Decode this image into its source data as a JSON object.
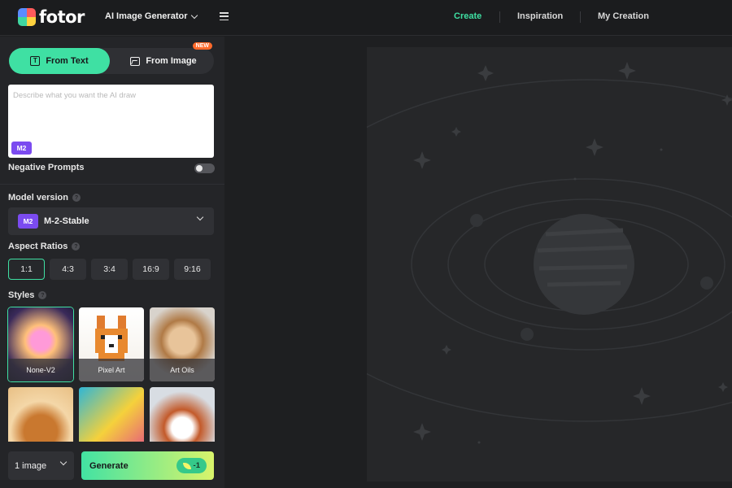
{
  "header": {
    "logo_text": "fotor",
    "product": "AI Image Generator",
    "nav": [
      {
        "label": "Create",
        "active": true
      },
      {
        "label": "Inspiration",
        "active": false
      },
      {
        "label": "My Creation",
        "active": false
      }
    ]
  },
  "sidebar": {
    "modes": {
      "from_text": "From Text",
      "from_image": "From Image",
      "new_badge": "NEW"
    },
    "prompt": {
      "placeholder": "Describe what you want the AI draw",
      "model_badge": "M2"
    },
    "negative_prompts": {
      "label": "Negative Prompts",
      "enabled": false
    },
    "model_version": {
      "label": "Model version",
      "badge": "M2",
      "selected": "M-2-Stable"
    },
    "aspect_ratios": {
      "label": "Aspect Ratios",
      "options": [
        "1:1",
        "4:3",
        "3:4",
        "16:9",
        "9:16"
      ],
      "selected": "1:1"
    },
    "styles": {
      "label": "Styles",
      "items": [
        {
          "label": "None-V2",
          "selected": true
        },
        {
          "label": "Pixel Art",
          "selected": false
        },
        {
          "label": "Art Oils",
          "selected": false
        },
        {
          "label": "",
          "selected": false
        },
        {
          "label": "",
          "selected": false
        },
        {
          "label": "",
          "selected": false
        }
      ]
    },
    "bottom": {
      "image_count": "1 image",
      "generate_label": "Generate",
      "credit_cost": "-1"
    }
  },
  "help_glyph": "?",
  "colors": {
    "accent": "#3fe0a3",
    "badge_purple": "#7b4bf0",
    "new_badge": "#ff6a2b"
  }
}
